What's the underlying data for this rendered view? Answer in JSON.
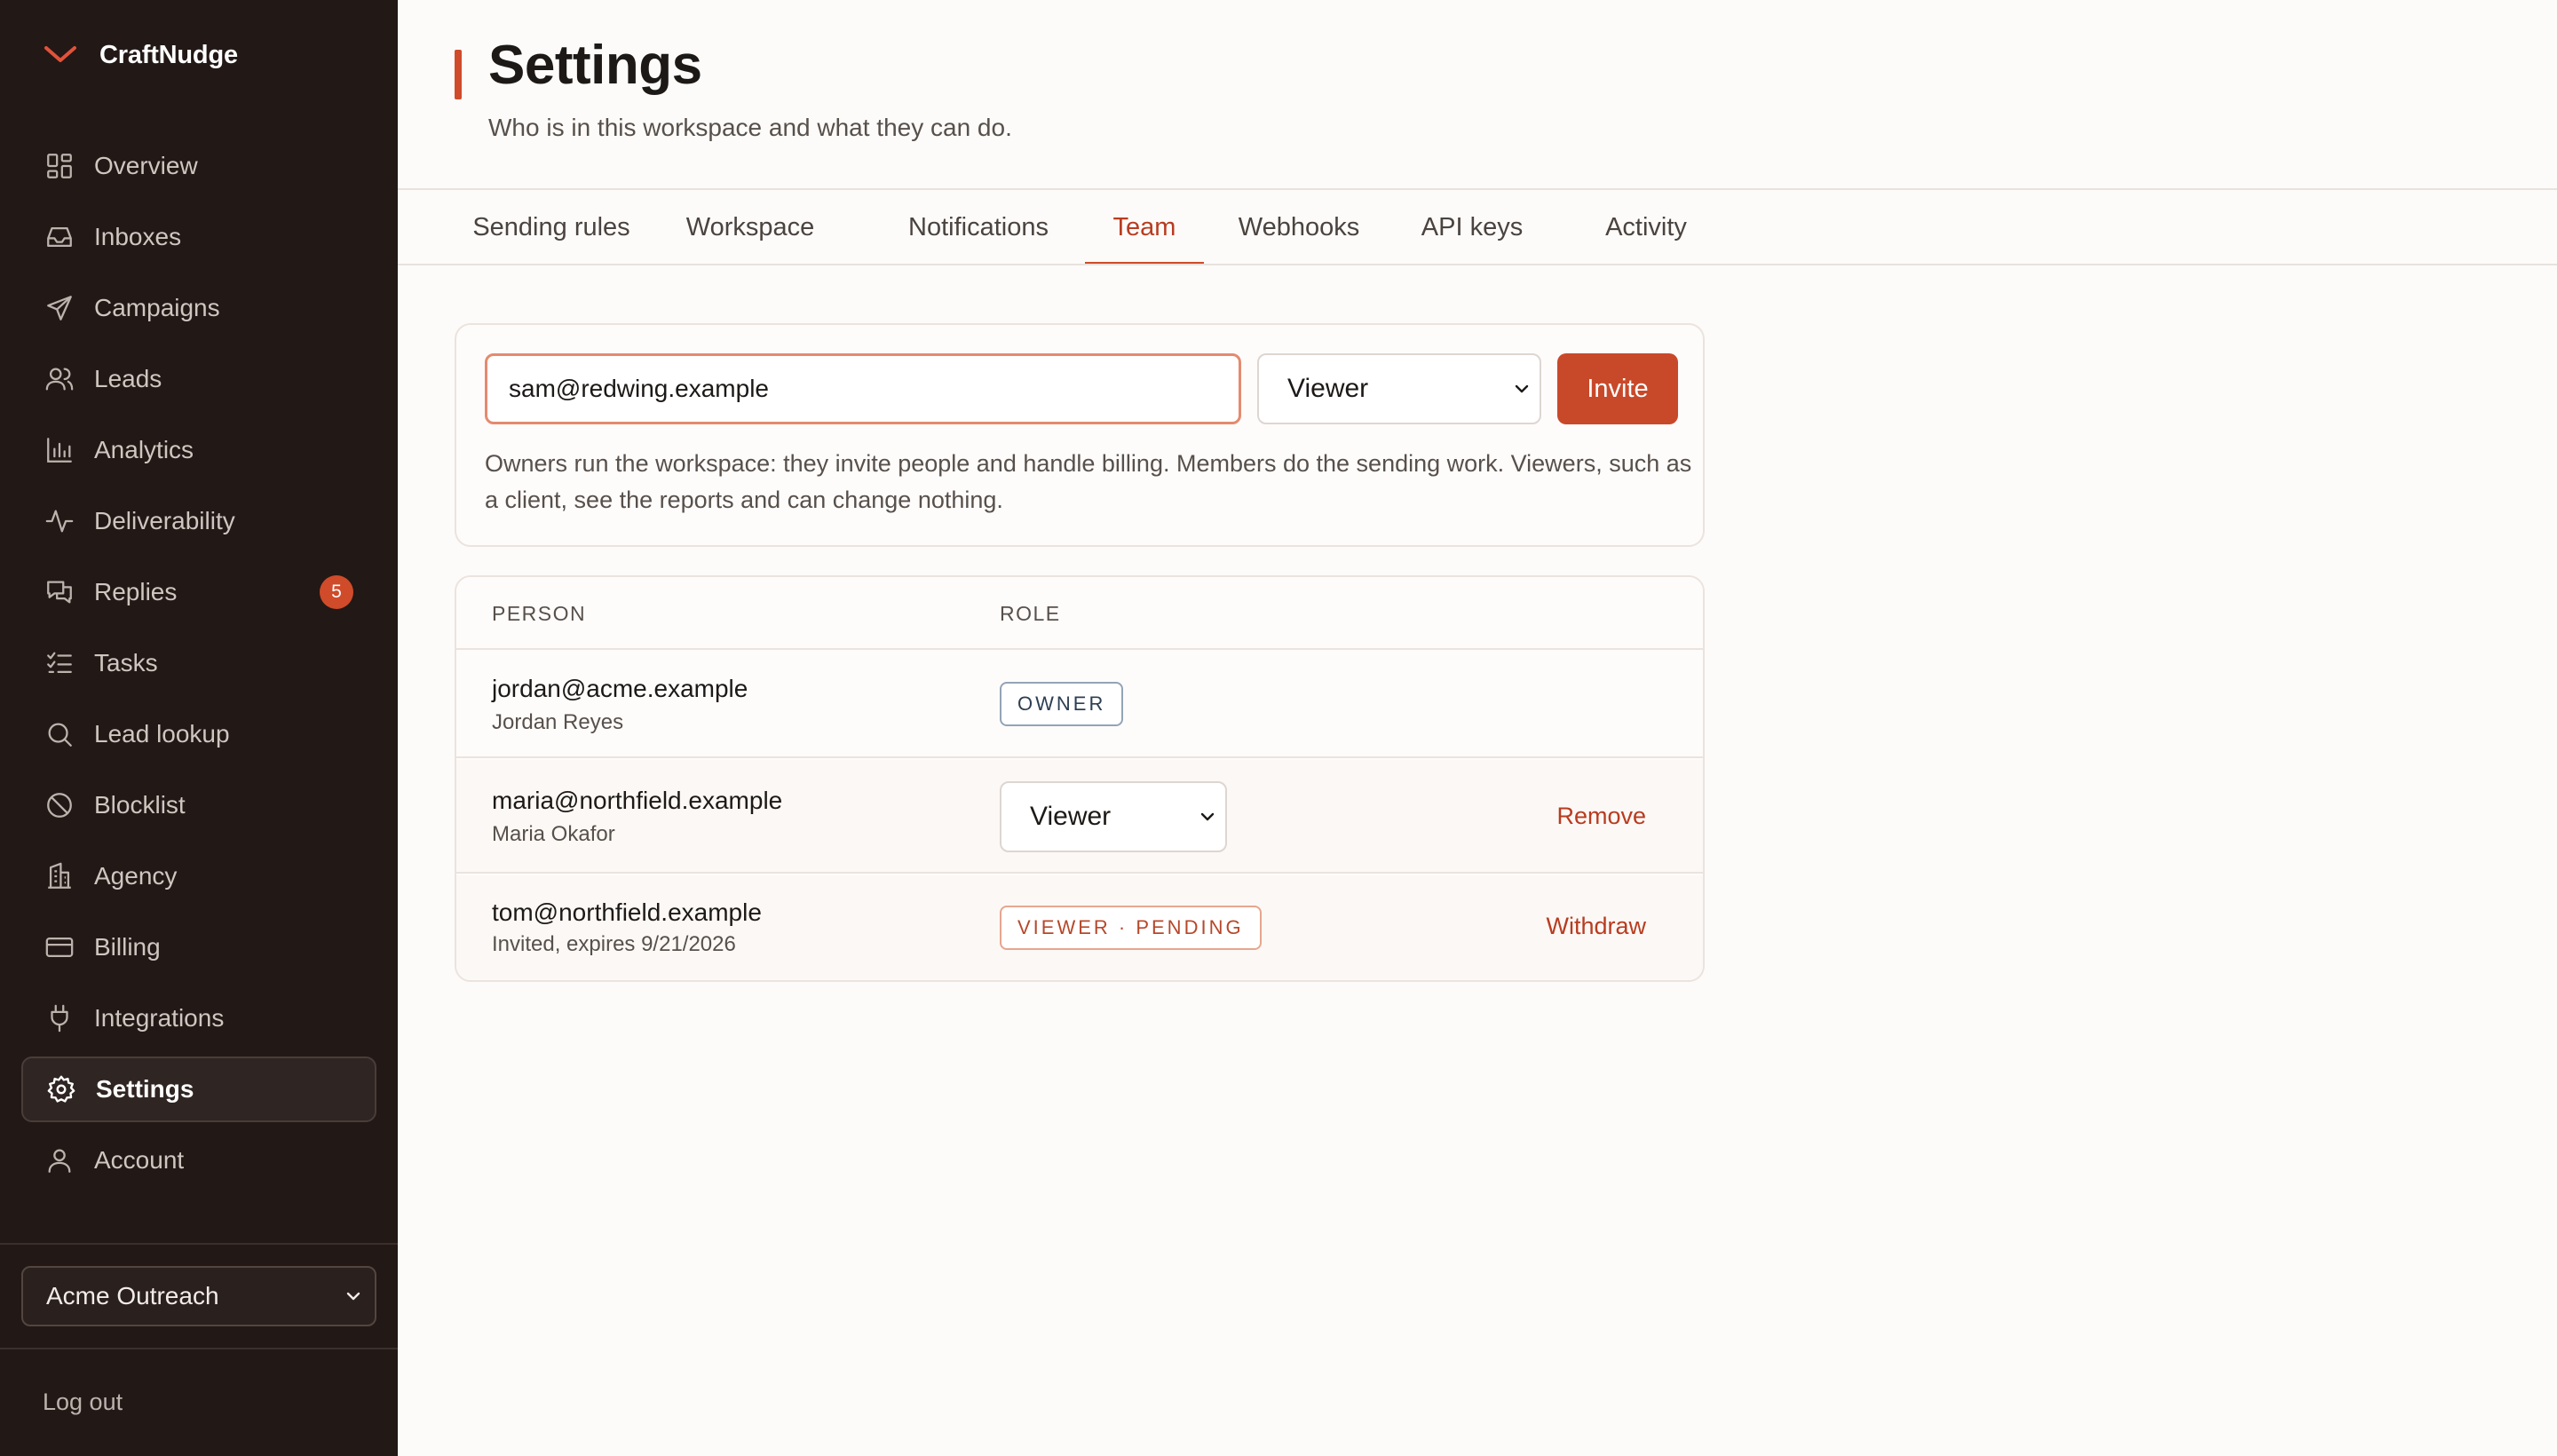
{
  "app": {
    "name": "CraftNudge"
  },
  "sidebar": {
    "items": [
      {
        "label": "Overview",
        "icon": "grid-icon"
      },
      {
        "label": "Inboxes",
        "icon": "inbox-icon"
      },
      {
        "label": "Campaigns",
        "icon": "send-icon"
      },
      {
        "label": "Leads",
        "icon": "users-icon"
      },
      {
        "label": "Analytics",
        "icon": "bar-chart-icon"
      },
      {
        "label": "Deliverability",
        "icon": "activity-icon"
      },
      {
        "label": "Replies",
        "icon": "chat-icon",
        "badge": "5"
      },
      {
        "label": "Tasks",
        "icon": "checklist-icon"
      },
      {
        "label": "Lead lookup",
        "icon": "search-icon"
      },
      {
        "label": "Blocklist",
        "icon": "ban-icon"
      },
      {
        "label": "Agency",
        "icon": "building-icon"
      },
      {
        "label": "Billing",
        "icon": "credit-card-icon"
      },
      {
        "label": "Integrations",
        "icon": "plug-icon"
      },
      {
        "label": "Settings",
        "icon": "gear-icon",
        "active": true
      },
      {
        "label": "Account",
        "icon": "user-icon"
      }
    ],
    "workspace_selected": "Acme Outreach",
    "logout_label": "Log out"
  },
  "header": {
    "title": "Settings",
    "subtitle": "Who is in this workspace and what they can do."
  },
  "tabs": [
    {
      "label": "Sending rules"
    },
    {
      "label": "Workspace"
    },
    {
      "label": "Notifications"
    },
    {
      "label": "Team",
      "active": true
    },
    {
      "label": "Webhooks"
    },
    {
      "label": "API keys"
    },
    {
      "label": "Activity"
    }
  ],
  "invite": {
    "email_value": "sam@redwing.example",
    "role_selected": "Viewer",
    "button_label": "Invite",
    "help_text": "Owners run the workspace: they invite people and handle billing. Members do the sending work. Viewers, such as a client, see the reports and can change nothing."
  },
  "team_table": {
    "headers": {
      "person": "PERSON",
      "role": "ROLE"
    },
    "rows": [
      {
        "email": "jordan@acme.example",
        "name": "Jordan Reyes",
        "role_badge": "OWNER"
      },
      {
        "email": "maria@northfield.example",
        "name": "Maria Okafor",
        "role_selected": "Viewer",
        "action": "Remove"
      },
      {
        "email": "tom@northfield.example",
        "name": "Invited, expires 9/21/2026",
        "role_badge": "VIEWER · PENDING",
        "action": "Withdraw"
      }
    ]
  },
  "colors": {
    "accent": "#cf4b2a",
    "sidebar_bg": "#221816",
    "link": "#b83c20"
  }
}
